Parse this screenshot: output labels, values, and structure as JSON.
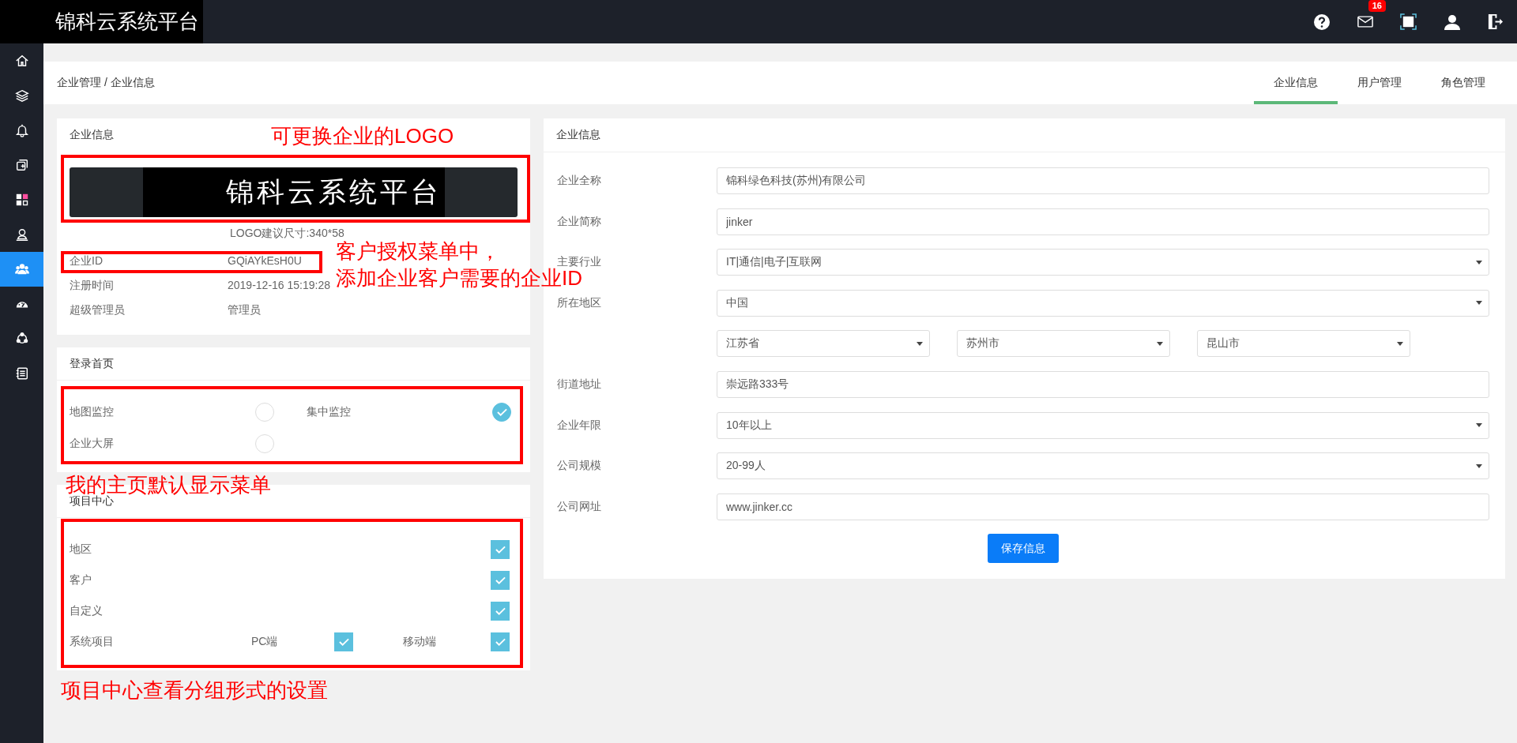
{
  "topbar": {
    "logo": "锦科云系统平台",
    "mail_badge": "16"
  },
  "sidebar": {
    "items": [
      {
        "kind": "home",
        "selected": false
      },
      {
        "kind": "layers",
        "selected": false
      },
      {
        "kind": "bell",
        "selected": false
      },
      {
        "kind": "copy",
        "selected": false
      },
      {
        "kind": "grid",
        "selected": false
      },
      {
        "kind": "user",
        "selected": false
      },
      {
        "kind": "group",
        "selected": true
      },
      {
        "kind": "gauge",
        "selected": false
      },
      {
        "kind": "nodes",
        "selected": false
      },
      {
        "kind": "list",
        "selected": false
      }
    ]
  },
  "breadcrumb": "企业管理 / 企业信息",
  "tabs": [
    {
      "label": "企业信息",
      "selected": true
    },
    {
      "label": "用户管理",
      "selected": false
    },
    {
      "label": "角色管理",
      "selected": false
    }
  ],
  "company_card": {
    "title": "企业信息",
    "logo_text": "锦科云系统平台",
    "logo_hint": "LOGO建议尺寸:340*58",
    "rows": [
      {
        "label": "企业ID",
        "value": "GQiAYkEsH0U"
      },
      {
        "label": "注册时间",
        "value": "2019-12-16 15:19:28"
      },
      {
        "label": "超级管理员",
        "value": "管理员"
      }
    ]
  },
  "login_home": {
    "title": "登录首页",
    "options": [
      {
        "label": "地图监控",
        "selected": false
      },
      {
        "label": "集中监控",
        "selected": true
      },
      {
        "label": "企业大屏",
        "selected": false
      }
    ]
  },
  "project_center": {
    "title": "项目中心",
    "items": [
      {
        "kind": "checkbox",
        "label": "地区",
        "checked": true
      },
      {
        "kind": "checkbox",
        "label": "客户",
        "checked": true
      },
      {
        "kind": "checkbox",
        "label": "自定义",
        "checked": true
      },
      {
        "kind": "group",
        "label": "系统项目",
        "options": [
          {
            "label": "PC端",
            "checked": true
          },
          {
            "label": "移动端",
            "checked": true
          }
        ]
      }
    ]
  },
  "form": {
    "title": "企业信息",
    "fields": [
      {
        "kind": "text",
        "label": "企业全称",
        "value": "锦科绿色科技(苏州)有限公司"
      },
      {
        "kind": "text",
        "label": "企业简称",
        "value": "jinker"
      },
      {
        "kind": "select",
        "label": "主要行业",
        "value": "IT|通信|电子|互联网"
      },
      {
        "kind": "select",
        "label": "所在地区",
        "value": "中国"
      },
      {
        "kind": "select-group",
        "selects": [
          {
            "value": "江苏省"
          },
          {
            "value": "苏州市"
          },
          {
            "value": "昆山市"
          }
        ]
      },
      {
        "kind": "text",
        "label": "街道地址",
        "value": "崇远路333号"
      },
      {
        "kind": "select",
        "label": "企业年限",
        "value": "10年以上"
      },
      {
        "kind": "select",
        "label": "公司规模",
        "value": "20-99人"
      },
      {
        "kind": "text",
        "label": "公司网址",
        "value": "www.jinker.cc"
      }
    ],
    "save_button": "保存信息"
  },
  "annotations": [
    "可更换企业的LOGO",
    "客户授权菜单中，",
    "添加企业客户需要的企业ID",
    "我的主页默认显示菜单",
    "项目中心查看分组形式的设置"
  ]
}
